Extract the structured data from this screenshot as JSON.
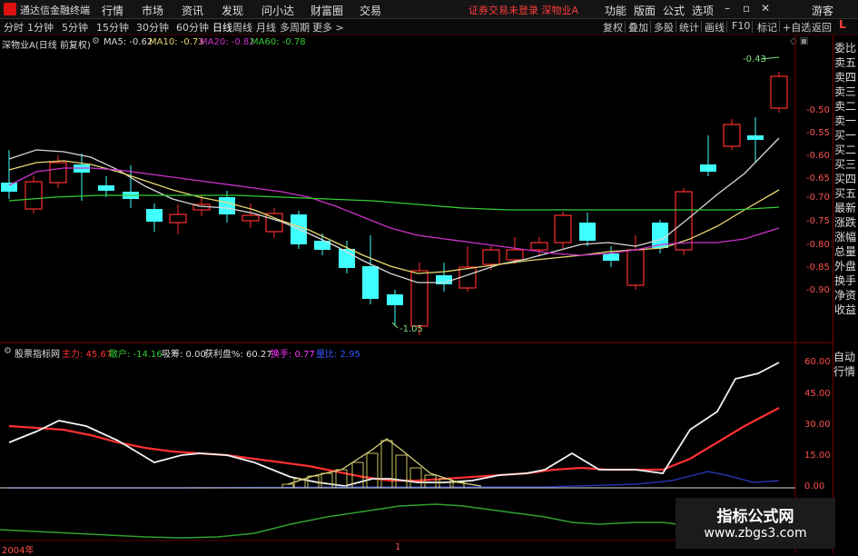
{
  "menubar": {
    "app_name": "通达信金融终端",
    "items": [
      "行情",
      "市场",
      "资讯",
      "发现",
      "问小达",
      "财富圈",
      "交易"
    ],
    "status": "证券交易未登录   深物业A",
    "right_items": [
      "功能",
      "版面",
      "公式",
      "选项"
    ],
    "guest": "游客"
  },
  "toolbar": {
    "periods": [
      "分时",
      "1分钟",
      "5分钟",
      "15分钟",
      "30分钟",
      "60分钟",
      "日线",
      "周线",
      "月线",
      "多周期",
      "更多 >"
    ],
    "active": "日线",
    "right": [
      "复权",
      "叠加",
      "多股",
      "统计",
      "画线",
      "F10",
      "标记",
      "+自选",
      "返回"
    ]
  },
  "main_chart": {
    "header": "深物业A(日线 前复权)",
    "ma": [
      {
        "label": "MA5: -0.62",
        "color": "#d8d8d8"
      },
      {
        "label": "MA10: -0.73",
        "color": "#e8d870"
      },
      {
        "label": "MA20: -0.82",
        "color": "#cc33cc"
      },
      {
        "label": "MA60: -0.78",
        "color": "#33cc33"
      }
    ],
    "high_label": "-0.43",
    "low_label": "-1.05",
    "yaxis": [
      "-0.50",
      "-0.55",
      "-0.60",
      "-0.65",
      "-0.70",
      "-0.75",
      "-0.80",
      "-0.85",
      "-0.90"
    ]
  },
  "indicator": {
    "name": "股票指标网",
    "items": [
      {
        "label": "主力: 45.67",
        "color": "#ff3333"
      },
      {
        "label": "散户: -14.16",
        "color": "#33cc33"
      },
      {
        "label": "吸筹: 0.00",
        "color": "#dddddd"
      },
      {
        "label": "获利盘%: 60.27",
        "color": "#dddddd"
      },
      {
        "label": "换手: 0.77",
        "color": "#ff33ff"
      },
      {
        "label": "量比: 2.95",
        "color": "#3355ff"
      }
    ],
    "yaxis": [
      "60.00",
      "45.00",
      "30.00",
      "15.00",
      "0.00"
    ]
  },
  "sidebar": {
    "top": "L",
    "items": [
      "委比",
      "卖五",
      "卖四",
      "卖三",
      "卖二",
      "卖一",
      "买一",
      "买二",
      "买三",
      "买四",
      "买五",
      "最新",
      "涨跌",
      "涨幅",
      "总量",
      "外盘",
      "换手",
      "净资",
      "收益"
    ],
    "bottom": [
      "自动",
      "行情"
    ]
  },
  "bottom": {
    "year": "2004年",
    "marker": "1"
  },
  "watermark": {
    "line1": "指标公式网",
    "line2": "www.zbgs3.com"
  },
  "colors": {
    "up": "#ff3030",
    "down": "#40ffff",
    "border": "#7a0000",
    "ma5": "#d8d8d8",
    "ma10": "#e8d870",
    "ma20": "#cc33cc",
    "ma60": "#33cc33"
  }
}
